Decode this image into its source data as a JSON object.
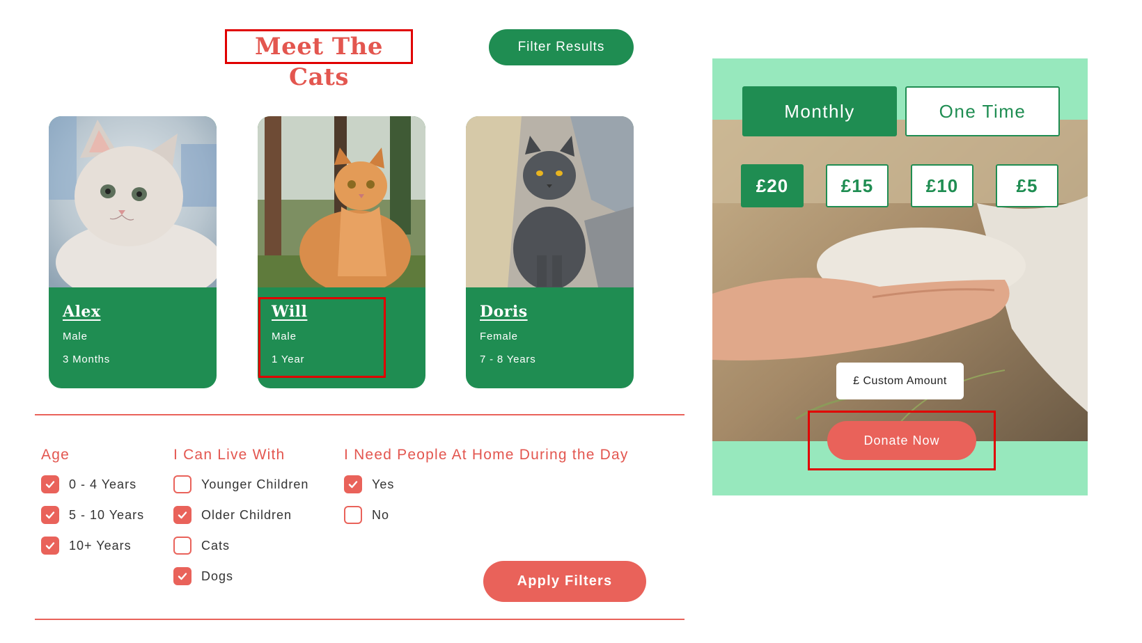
{
  "header": {
    "title": "Meet The Cats",
    "filter_button": "Filter Results"
  },
  "cats": [
    {
      "name": "Alex",
      "sex": "Male",
      "age": "3 Months"
    },
    {
      "name": "Will",
      "sex": "Male",
      "age": "1 Year"
    },
    {
      "name": "Doris",
      "sex": "Female",
      "age": "7 - 8 Years"
    }
  ],
  "filters": {
    "age": {
      "heading": "Age",
      "options": [
        {
          "label": "0 - 4 Years",
          "checked": true
        },
        {
          "label": "5 - 10 Years",
          "checked": true
        },
        {
          "label": "10+ Years",
          "checked": true
        }
      ]
    },
    "live_with": {
      "heading": "I Can Live With",
      "options": [
        {
          "label": "Younger Children",
          "checked": false
        },
        {
          "label": "Older Children",
          "checked": true
        },
        {
          "label": "Cats",
          "checked": false
        },
        {
          "label": "Dogs",
          "checked": true
        }
      ]
    },
    "people_home": {
      "heading": "I Need People At Home During the Day",
      "options": [
        {
          "label": "Yes",
          "checked": true
        },
        {
          "label": "No",
          "checked": false
        }
      ]
    },
    "apply_button": "Apply Filters"
  },
  "donate": {
    "frequency": {
      "monthly": "Monthly",
      "one_time": "One Time",
      "selected": "Monthly"
    },
    "amounts": [
      {
        "label": "£20",
        "selected": true
      },
      {
        "label": "£15",
        "selected": false
      },
      {
        "label": "£10",
        "selected": false
      },
      {
        "label": "£5",
        "selected": false
      }
    ],
    "custom_amount": "£ Custom Amount",
    "donate_button": "Donate Now"
  },
  "colors": {
    "brand_green": "#1f8d52",
    "accent_red": "#e9625a",
    "panel_mint": "#97e8bd",
    "highlight_box": "#e00000"
  },
  "icons": {
    "checkbox_checked": "check-icon"
  }
}
